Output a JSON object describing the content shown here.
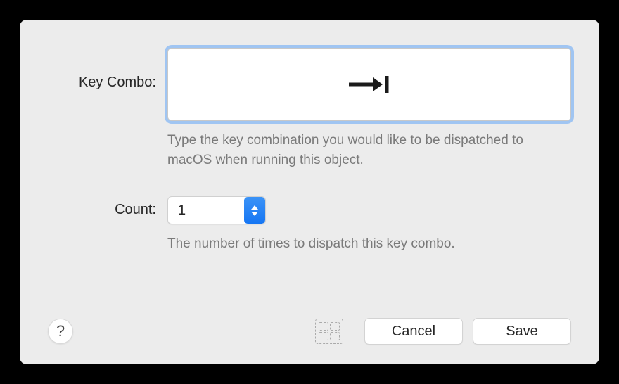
{
  "keyCombo": {
    "label": "Key Combo:",
    "keyIcon": "tab-key-icon",
    "helpText": "Type the key combination you would like to be dispatched to macOS when running this object."
  },
  "count": {
    "label": "Count:",
    "value": "1",
    "helpText": "The number of times to dispatch this key combo."
  },
  "buttons": {
    "help": "?",
    "cancel": "Cancel",
    "save": "Save"
  }
}
